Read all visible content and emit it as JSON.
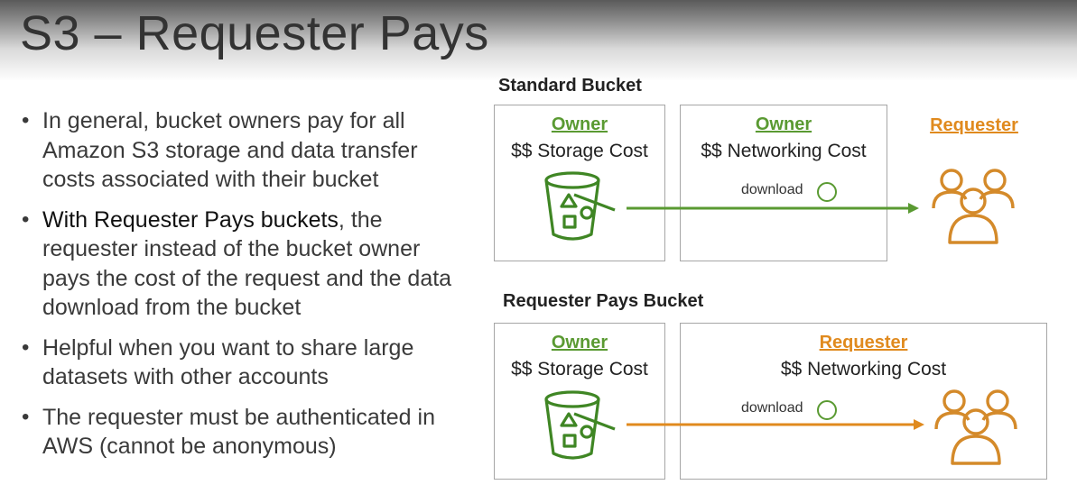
{
  "title": "S3 – Requester Pays",
  "bullets": [
    {
      "prefix": "In general, bucket owners pay for all Amazon S3 storage and data transfer costs associated with their bucket",
      "emph": "",
      "suffix": ""
    },
    {
      "prefix": "",
      "emph": "With Requester Pays buckets",
      "suffix": ", the requester instead of the bucket owner pays the cost of the request and the data download from the bucket"
    },
    {
      "prefix": "Helpful when you want to share large datasets with other accounts",
      "emph": "",
      "suffix": ""
    },
    {
      "prefix": "The requester must be authenticated in AWS (cannot be anonymous)",
      "emph": "",
      "suffix": ""
    }
  ],
  "standard": {
    "label": "Standard Bucket",
    "storage_box": {
      "role": "Owner",
      "cost": "$$ Storage Cost"
    },
    "network_box": {
      "role": "Owner",
      "cost": "$$ Networking Cost"
    },
    "download_label": "download",
    "requester_label": "Requester"
  },
  "requester_pays": {
    "label": "Requester Pays Bucket",
    "storage_box": {
      "role": "Owner",
      "cost": "$$ Storage Cost"
    },
    "network_box": {
      "role": "Requester",
      "cost": "$$ Networking Cost"
    },
    "download_label": "download"
  },
  "colors": {
    "owner_green": "#5a9a32",
    "requester_orange": "#e08a1e",
    "bucket_green": "#3f8624",
    "users_orange": "#d48a2a"
  },
  "icons": {
    "bucket": "s3-bucket-icon",
    "users": "users-group-icon",
    "download": "download-circle-icon",
    "arrow": "arrow-right-icon"
  }
}
